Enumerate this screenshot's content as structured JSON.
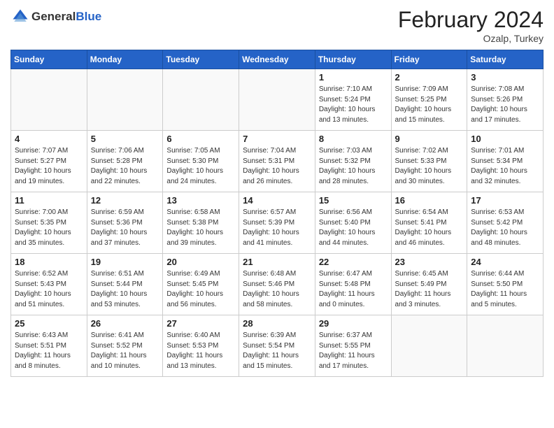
{
  "header": {
    "logo_general": "General",
    "logo_blue": "Blue",
    "month": "February 2024",
    "location": "Ozalp, Turkey"
  },
  "weekdays": [
    "Sunday",
    "Monday",
    "Tuesday",
    "Wednesday",
    "Thursday",
    "Friday",
    "Saturday"
  ],
  "weeks": [
    [
      {
        "day": "",
        "detail": ""
      },
      {
        "day": "",
        "detail": ""
      },
      {
        "day": "",
        "detail": ""
      },
      {
        "day": "",
        "detail": ""
      },
      {
        "day": "1",
        "detail": "Sunrise: 7:10 AM\nSunset: 5:24 PM\nDaylight: 10 hours\nand 13 minutes."
      },
      {
        "day": "2",
        "detail": "Sunrise: 7:09 AM\nSunset: 5:25 PM\nDaylight: 10 hours\nand 15 minutes."
      },
      {
        "day": "3",
        "detail": "Sunrise: 7:08 AM\nSunset: 5:26 PM\nDaylight: 10 hours\nand 17 minutes."
      }
    ],
    [
      {
        "day": "4",
        "detail": "Sunrise: 7:07 AM\nSunset: 5:27 PM\nDaylight: 10 hours\nand 19 minutes."
      },
      {
        "day": "5",
        "detail": "Sunrise: 7:06 AM\nSunset: 5:28 PM\nDaylight: 10 hours\nand 22 minutes."
      },
      {
        "day": "6",
        "detail": "Sunrise: 7:05 AM\nSunset: 5:30 PM\nDaylight: 10 hours\nand 24 minutes."
      },
      {
        "day": "7",
        "detail": "Sunrise: 7:04 AM\nSunset: 5:31 PM\nDaylight: 10 hours\nand 26 minutes."
      },
      {
        "day": "8",
        "detail": "Sunrise: 7:03 AM\nSunset: 5:32 PM\nDaylight: 10 hours\nand 28 minutes."
      },
      {
        "day": "9",
        "detail": "Sunrise: 7:02 AM\nSunset: 5:33 PM\nDaylight: 10 hours\nand 30 minutes."
      },
      {
        "day": "10",
        "detail": "Sunrise: 7:01 AM\nSunset: 5:34 PM\nDaylight: 10 hours\nand 32 minutes."
      }
    ],
    [
      {
        "day": "11",
        "detail": "Sunrise: 7:00 AM\nSunset: 5:35 PM\nDaylight: 10 hours\nand 35 minutes."
      },
      {
        "day": "12",
        "detail": "Sunrise: 6:59 AM\nSunset: 5:36 PM\nDaylight: 10 hours\nand 37 minutes."
      },
      {
        "day": "13",
        "detail": "Sunrise: 6:58 AM\nSunset: 5:38 PM\nDaylight: 10 hours\nand 39 minutes."
      },
      {
        "day": "14",
        "detail": "Sunrise: 6:57 AM\nSunset: 5:39 PM\nDaylight: 10 hours\nand 41 minutes."
      },
      {
        "day": "15",
        "detail": "Sunrise: 6:56 AM\nSunset: 5:40 PM\nDaylight: 10 hours\nand 44 minutes."
      },
      {
        "day": "16",
        "detail": "Sunrise: 6:54 AM\nSunset: 5:41 PM\nDaylight: 10 hours\nand 46 minutes."
      },
      {
        "day": "17",
        "detail": "Sunrise: 6:53 AM\nSunset: 5:42 PM\nDaylight: 10 hours\nand 48 minutes."
      }
    ],
    [
      {
        "day": "18",
        "detail": "Sunrise: 6:52 AM\nSunset: 5:43 PM\nDaylight: 10 hours\nand 51 minutes."
      },
      {
        "day": "19",
        "detail": "Sunrise: 6:51 AM\nSunset: 5:44 PM\nDaylight: 10 hours\nand 53 minutes."
      },
      {
        "day": "20",
        "detail": "Sunrise: 6:49 AM\nSunset: 5:45 PM\nDaylight: 10 hours\nand 56 minutes."
      },
      {
        "day": "21",
        "detail": "Sunrise: 6:48 AM\nSunset: 5:46 PM\nDaylight: 10 hours\nand 58 minutes."
      },
      {
        "day": "22",
        "detail": "Sunrise: 6:47 AM\nSunset: 5:48 PM\nDaylight: 11 hours\nand 0 minutes."
      },
      {
        "day": "23",
        "detail": "Sunrise: 6:45 AM\nSunset: 5:49 PM\nDaylight: 11 hours\nand 3 minutes."
      },
      {
        "day": "24",
        "detail": "Sunrise: 6:44 AM\nSunset: 5:50 PM\nDaylight: 11 hours\nand 5 minutes."
      }
    ],
    [
      {
        "day": "25",
        "detail": "Sunrise: 6:43 AM\nSunset: 5:51 PM\nDaylight: 11 hours\nand 8 minutes."
      },
      {
        "day": "26",
        "detail": "Sunrise: 6:41 AM\nSunset: 5:52 PM\nDaylight: 11 hours\nand 10 minutes."
      },
      {
        "day": "27",
        "detail": "Sunrise: 6:40 AM\nSunset: 5:53 PM\nDaylight: 11 hours\nand 13 minutes."
      },
      {
        "day": "28",
        "detail": "Sunrise: 6:39 AM\nSunset: 5:54 PM\nDaylight: 11 hours\nand 15 minutes."
      },
      {
        "day": "29",
        "detail": "Sunrise: 6:37 AM\nSunset: 5:55 PM\nDaylight: 11 hours\nand 17 minutes."
      },
      {
        "day": "",
        "detail": ""
      },
      {
        "day": "",
        "detail": ""
      }
    ]
  ]
}
